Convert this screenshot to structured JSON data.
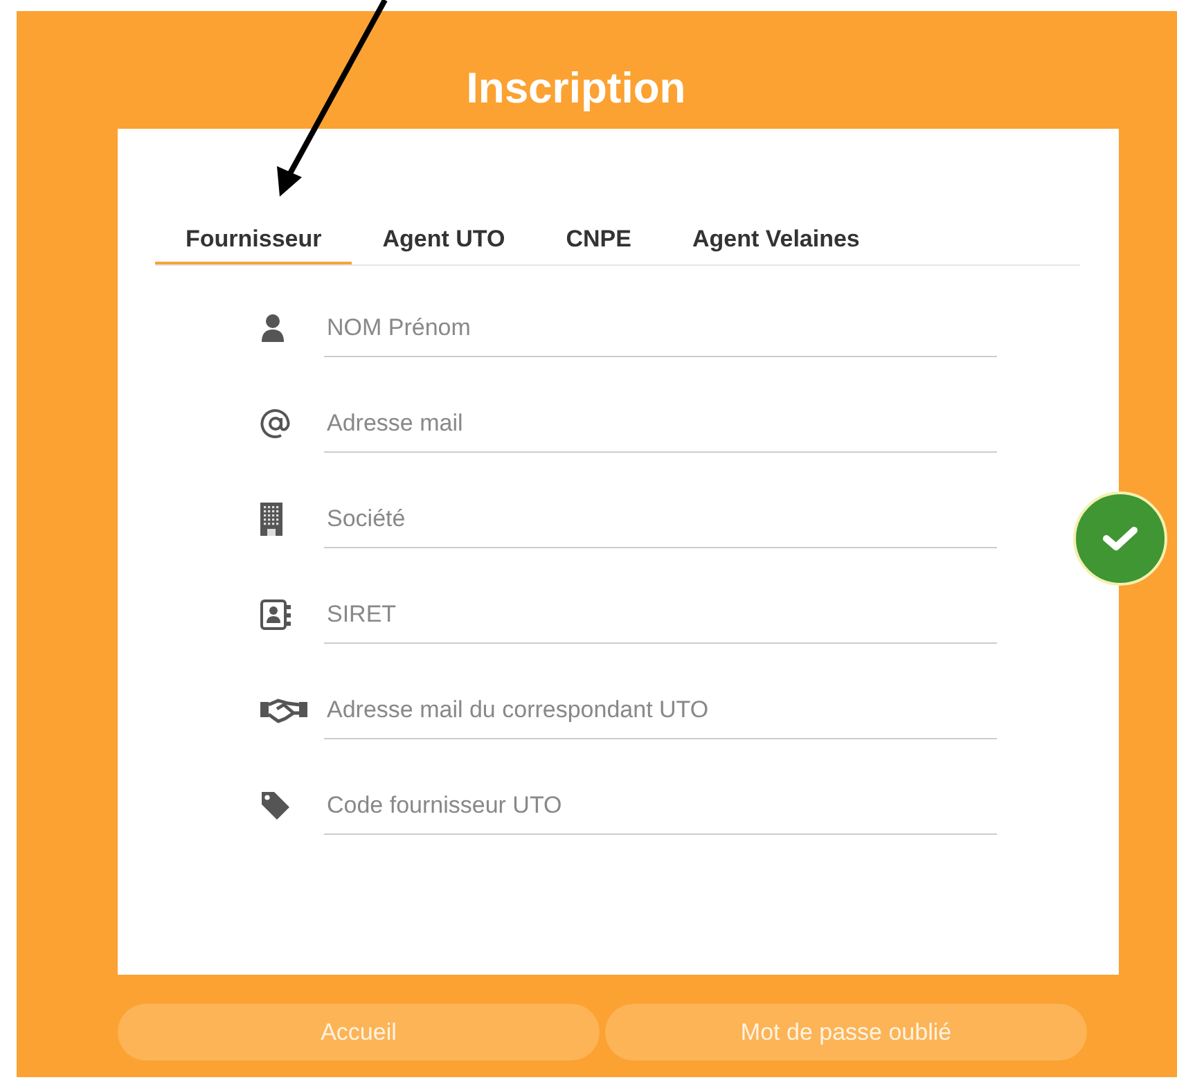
{
  "title": "Inscription",
  "tabs": [
    {
      "label": "Fournisseur",
      "selected": true
    },
    {
      "label": "Agent UTO",
      "selected": false
    },
    {
      "label": "CNPE",
      "selected": false
    },
    {
      "label": "Agent Velaines",
      "selected": false
    }
  ],
  "fields": [
    {
      "placeholder": "NOM Prénom"
    },
    {
      "placeholder": "Adresse mail"
    },
    {
      "placeholder": "Société"
    },
    {
      "placeholder": "SIRET"
    },
    {
      "placeholder": "Adresse mail du correspondant UTO"
    },
    {
      "placeholder": "Code fournisseur UTO"
    }
  ],
  "buttons": [
    "Accueil",
    "Mot de passe oublié"
  ]
}
